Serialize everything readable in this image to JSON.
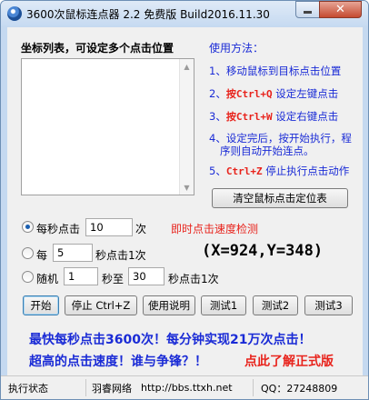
{
  "window": {
    "title": "3600次鼠标连点器 2.2 免费版   Build2016.11.30",
    "close_glyph": "✕"
  },
  "coords": {
    "header": "坐标列表，可设定多个点击位置",
    "items": []
  },
  "usage": {
    "title": "使用方法：",
    "step1": "1、移动鼠标到目标点击位置",
    "step2_prefix": "2、",
    "step2_key": "按Ctrl+Q",
    "step2_text": " 设定左键点击",
    "step3_prefix": "3、",
    "step3_key": "按Ctrl+W",
    "step3_text": " 设定右键点击",
    "step4_line1": "4、设定完后，按开始执行，程",
    "step4_line2": "序则自动开始连点。",
    "step5_prefix": "5、",
    "step5_key": "Ctrl+Z",
    "step5_text": " 停止执行点击动作"
  },
  "clear_button": "清空鼠标点击定位表",
  "speed": {
    "opt1_label": "每秒点击",
    "opt1_value": "10",
    "opt1_unit": "次",
    "realtime_label": "即时点击速度检测",
    "opt2_label": "每",
    "opt2_value": "5",
    "opt2_unit": "秒点击1次",
    "opt3_label": "随机",
    "opt3_min": "1",
    "opt3_mid": "秒至",
    "opt3_max": "30",
    "opt3_unit": "秒点击1次",
    "selected": 1
  },
  "readout": "(X=924,Y=348)",
  "buttons": {
    "start": "开始",
    "stop": "停止 Ctrl+Z",
    "help": "使用说明",
    "test1": "测试1",
    "test2": "测试2",
    "test3": "测试3"
  },
  "promo": {
    "line1": "最快每秒点击3600次！每分钟实现21万次点击！",
    "line2": "超高的点击速度！谁与争锋？！",
    "link": "点此了解正式版"
  },
  "status": {
    "state": "执行状态",
    "company": "羽睿网络",
    "url": "http://bbs.ttxh.net",
    "qq": "QQ：27248809"
  },
  "colors": {
    "blue_text": "#1a2bd6",
    "red_text": "#e8231c"
  }
}
